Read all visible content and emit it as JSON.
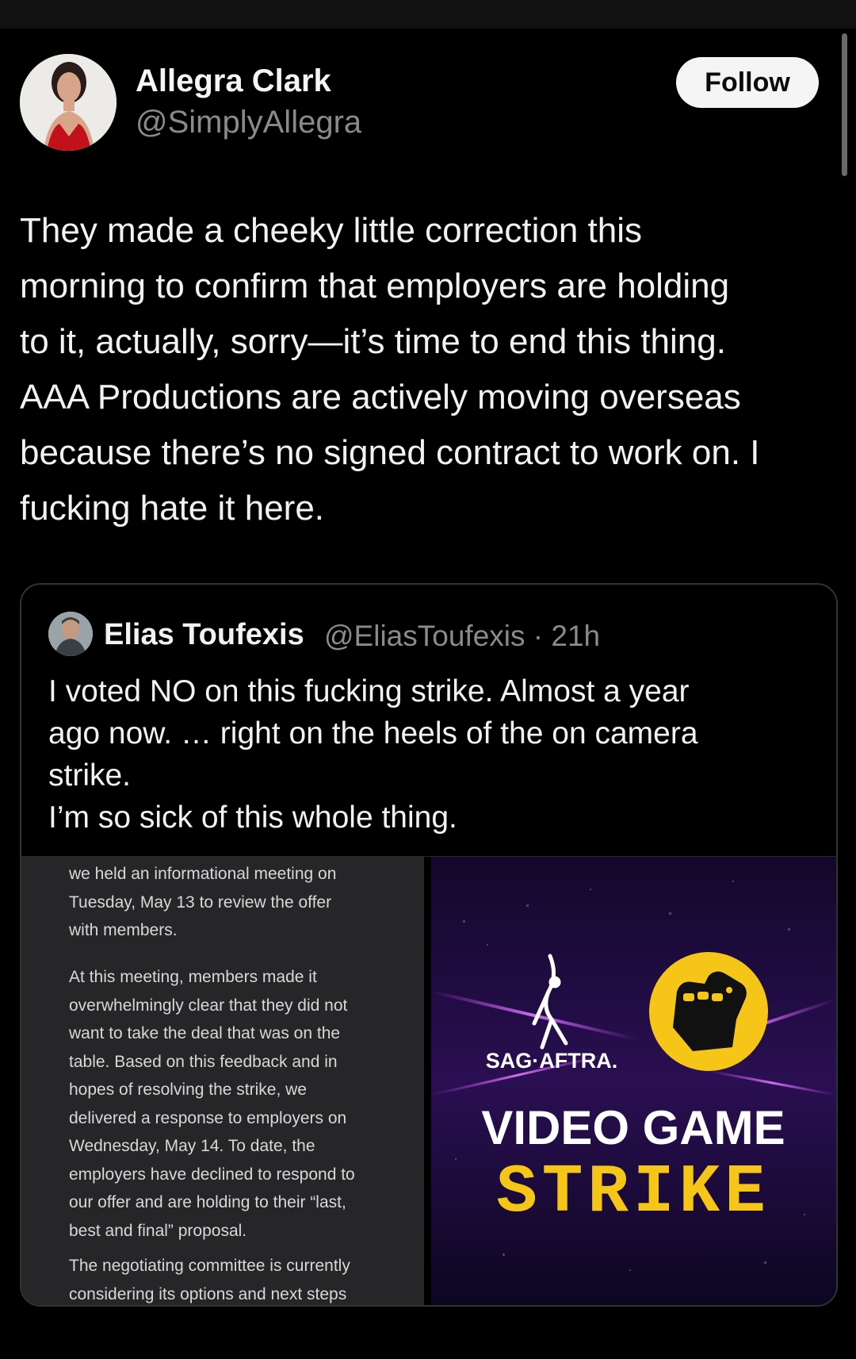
{
  "author": {
    "name": "Allegra Clark",
    "handle": "@SimplyAllegra",
    "follow_label": "Follow"
  },
  "tweet": {
    "text": "They made a cheeky little correction this\nmorning to confirm that employers are holding\nto it, actually, sorry—it’s time to end this thing.\nAAA Productions are actively moving overseas\nbecause there’s no signed contract to work on. I\nfucking hate it here."
  },
  "quote": {
    "name": "Elias Toufexis",
    "handle": "@EliasToufexis",
    "time": "21h",
    "meta": "@EliasToufexis · 21h",
    "text": "I voted NO on this fucking strike. Almost a year\nago now. … right on the heels of the on camera\nstrike.\nI’m so sick of this whole thing.",
    "doc_paragraphs": [
      "we held an informational meeting on\nTuesday, May 13 to review the offer\nwith members.",
      "At this meeting, members made it\noverwhelmingly clear that they did not\nwant to take the deal that was on the\ntable. Based on this feedback and in\nhopes of resolving the strike, we\ndelivered a response to employers on\nWednesday, May 14. To date, the\nemployers have declined to respond to\nour offer and are holding to their “last,\nbest and final” proposal.",
      "The negotiating committee is currently\nconsidering its options and next steps"
    ],
    "image": {
      "brand": "SAG·AFTRA.",
      "line1": "VIDEO GAME",
      "line2": "STRIKE",
      "accent": "#f5c518",
      "bg": "#1a0a33"
    }
  }
}
